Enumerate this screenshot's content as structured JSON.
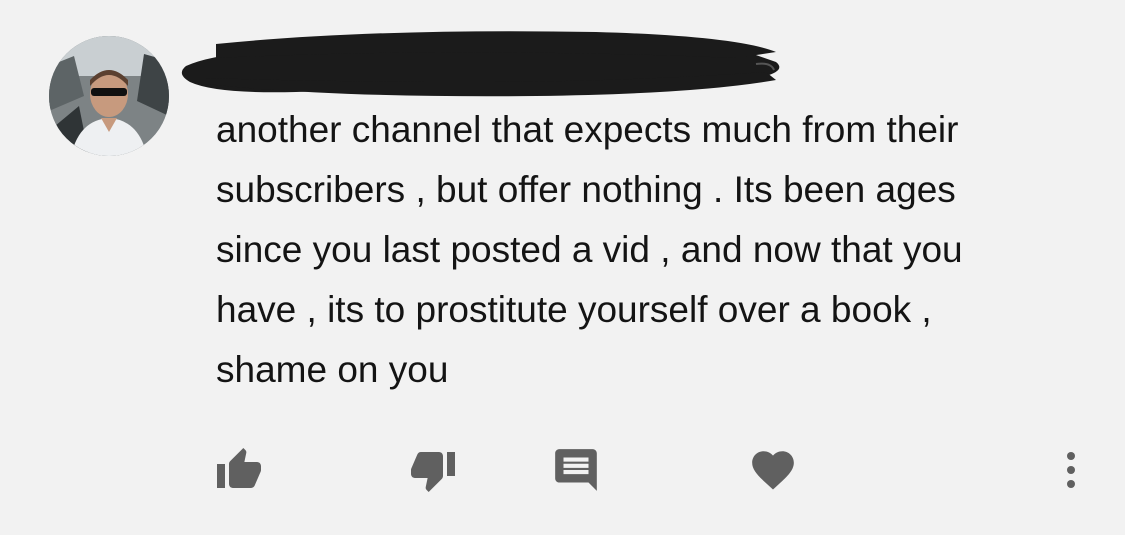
{
  "comment": {
    "author": "",
    "text_lines": [
      "another channel that expects much from their",
      "subscribers , but offer nothing . Its been ages",
      "since you last posted a vid , and now that you",
      "have , its to prostitute yourself over a book ,",
      "shame on you"
    ]
  },
  "actions": {
    "like_icon": "thumbs-up-icon",
    "dislike_icon": "thumbs-down-icon",
    "reply_icon": "comment-bubble-icon",
    "heart_icon": "heart-icon",
    "more_icon": "more-vertical-icon"
  },
  "colors": {
    "background": "#f2f2f2",
    "text": "#141414",
    "icon": "#606060",
    "redaction": "#1b1b1b"
  }
}
